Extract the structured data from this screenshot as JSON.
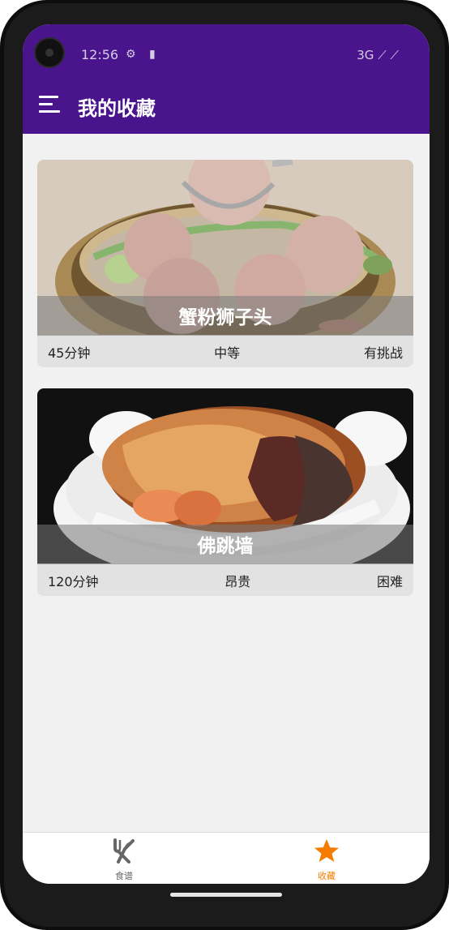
{
  "status_bar": {
    "time": "12:56",
    "network": "3G"
  },
  "app_bar": {
    "title": "我的收藏"
  },
  "favorites": [
    {
      "name": "蟹粉狮子头",
      "time": "45分钟",
      "cost": "中等",
      "difficulty": "有挑战"
    },
    {
      "name": "佛跳墙",
      "time": "120分钟",
      "cost": "昂贵",
      "difficulty": "困难"
    }
  ],
  "bottom_nav": {
    "recipes_label": "食谱",
    "favorites_label": "收藏",
    "active_color": "#f57c00",
    "inactive_color": "#666666"
  },
  "colors": {
    "app_bar": "#4a148c",
    "background": "#f1f1f1"
  }
}
